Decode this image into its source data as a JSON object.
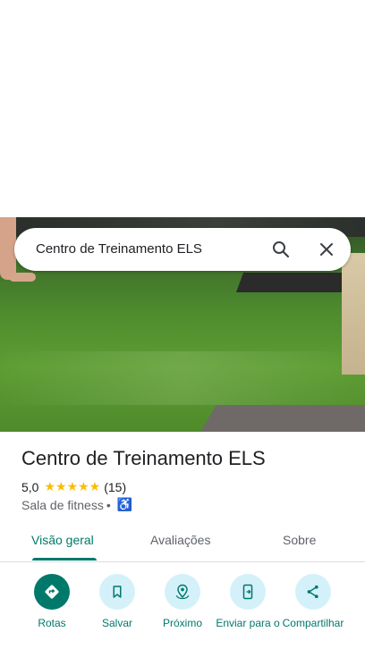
{
  "search": {
    "query": "Centro de Treinamento ELS"
  },
  "place": {
    "name": "Centro de Treinamento ELS",
    "rating": "5,0",
    "stars": "★★★★★",
    "review_count": "(15)",
    "category": "Sala de fitness",
    "separator": "•",
    "accessibility_icon": "♿"
  },
  "tabs": [
    {
      "label": "Visão geral",
      "active": true
    },
    {
      "label": "Avaliações",
      "active": false
    },
    {
      "label": "Sobre",
      "active": false
    }
  ],
  "actions": [
    {
      "label": "Rotas",
      "icon": "directions-icon"
    },
    {
      "label": "Salvar",
      "icon": "bookmark-icon"
    },
    {
      "label": "Próximo",
      "icon": "nearby-icon"
    },
    {
      "label": "Enviar para o",
      "icon": "send-to-phone-icon"
    },
    {
      "label": "Compartilhar",
      "icon": "share-icon"
    }
  ],
  "colors": {
    "accent": "#00796b",
    "action_bg": "#d4f1fa",
    "star": "#fbbc04"
  }
}
